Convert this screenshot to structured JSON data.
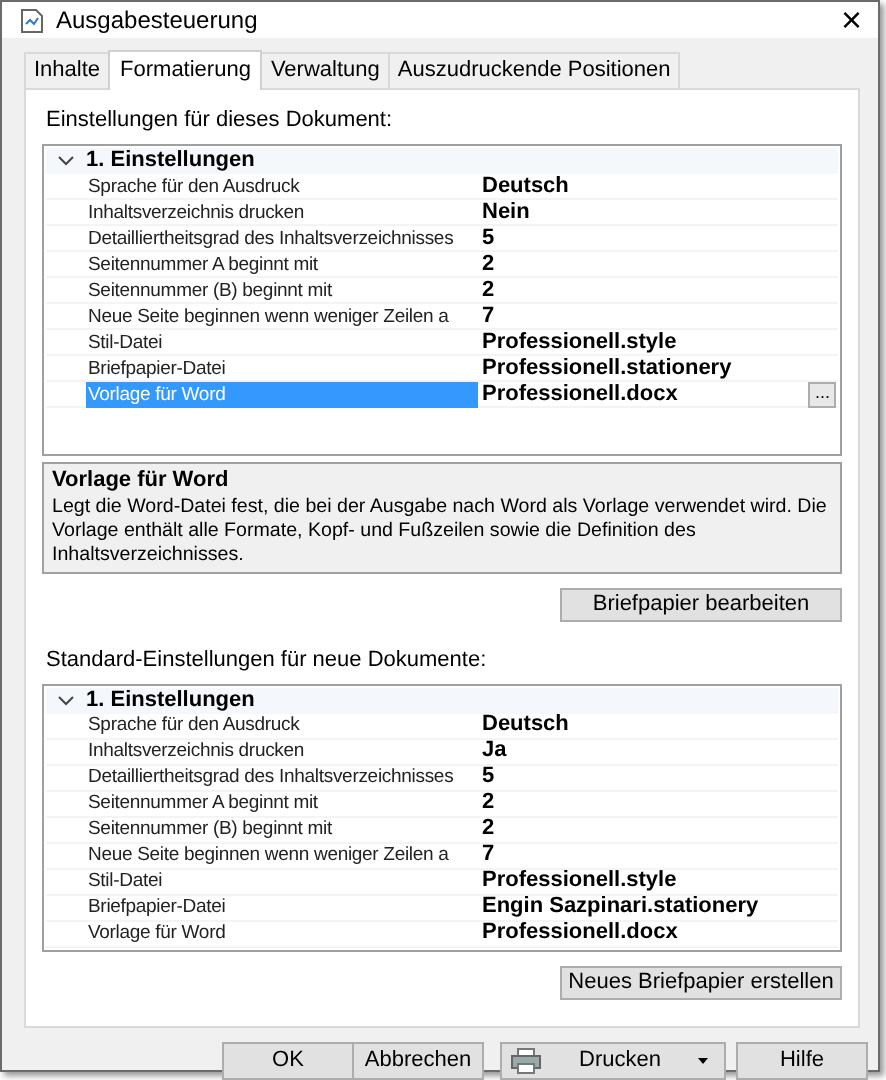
{
  "window": {
    "title": "Ausgabesteuerung",
    "close": "×"
  },
  "tabs": [
    {
      "label": "Inhalte",
      "selected": false
    },
    {
      "label": "Formatierung",
      "selected": true
    },
    {
      "label": "Verwaltung",
      "selected": false
    },
    {
      "label": "Auszudruckende Positionen",
      "selected": false
    }
  ],
  "sections": [
    {
      "heading": "Einstellungen für dieses Dokument:",
      "category": "1. Einstellungen",
      "expanded": true,
      "rows": [
        {
          "label": "Sprache für den Ausdruck",
          "value": "Deutsch",
          "selected": false
        },
        {
          "label": "Inhaltsverzeichnis drucken",
          "value": "Nein",
          "selected": false
        },
        {
          "label": "Detailliertheitsgrad des Inhaltsverzeichnisses",
          "value": "5",
          "selected": false
        },
        {
          "label": "Seitennummer A beginnt mit",
          "value": "2",
          "selected": false
        },
        {
          "label": "Seitennummer (B) beginnt mit",
          "value": "2",
          "selected": false
        },
        {
          "label": "Neue Seite beginnen wenn weniger Zeilen a",
          "value": "7",
          "selected": false
        },
        {
          "label": "Stil-Datei",
          "value": "Professionell.style",
          "selected": false
        },
        {
          "label": "Briefpapier-Datei",
          "value": "Professionell.stationery",
          "selected": false
        },
        {
          "label": "Vorlage für Word",
          "value": "Professionell.docx",
          "selected": true,
          "button": "..."
        }
      ],
      "description": {
        "title": "Vorlage für Word",
        "text": "Legt die Word-Datei fest, die bei der Ausgabe nach Word als Vorlage verwendet wird. Die Vorlage enthält alle Formate, Kopf- und Fußzeilen sowie die Definition des Inhaltsverzeichnisses."
      },
      "button": "Briefpapier bearbeiten"
    },
    {
      "heading": "Standard-Einstellungen für neue Dokumente:",
      "category": "1. Einstellungen",
      "expanded": true,
      "rows": [
        {
          "label": "Sprache für den Ausdruck",
          "value": "Deutsch",
          "selected": false
        },
        {
          "label": "Inhaltsverzeichnis drucken",
          "value": "Ja",
          "selected": false
        },
        {
          "label": "Detailliertheitsgrad des Inhaltsverzeichnisses",
          "value": "5",
          "selected": false
        },
        {
          "label": "Seitennummer A beginnt mit",
          "value": "2",
          "selected": false
        },
        {
          "label": "Seitennummer (B) beginnt mit",
          "value": "2",
          "selected": false
        },
        {
          "label": "Neue Seite beginnen wenn weniger Zeilen a",
          "value": "7",
          "selected": false
        },
        {
          "label": "Stil-Datei",
          "value": "Professionell.style",
          "selected": false
        },
        {
          "label": "Briefpapier-Datei",
          "value": "Engin Sazpinari.stationery",
          "selected": false
        },
        {
          "label": "Vorlage für Word",
          "value": "Professionell.docx",
          "selected": false
        }
      ],
      "button": "Neues Briefpapier erstellen"
    }
  ],
  "buttons": [
    {
      "kind": "plain",
      "label": "OK"
    },
    {
      "kind": "plain",
      "label": "Abbrechen"
    },
    {
      "kind": "split",
      "label": "Drucken"
    },
    {
      "kind": "plain",
      "label": "Hilfe"
    }
  ]
}
